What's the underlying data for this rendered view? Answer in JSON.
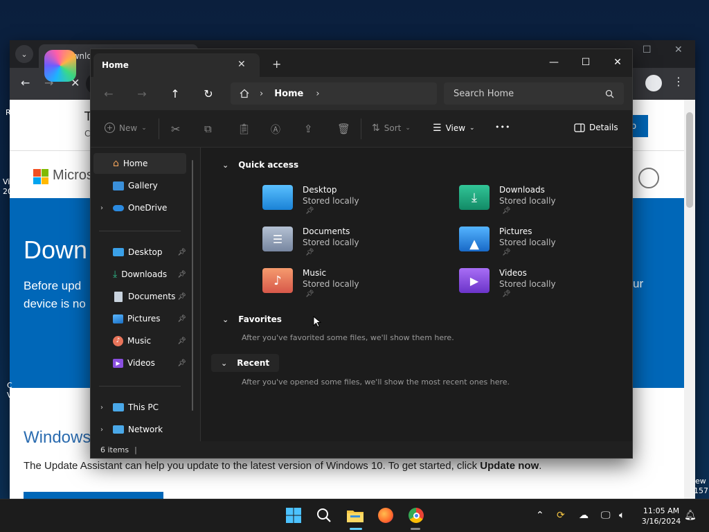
{
  "browser": {
    "tab_title": "Downlo",
    "copilot_fragment_title": "T",
    "copilot_fragment_sub": "C",
    "copilot_button_fragment": "p",
    "ms_word": "Micros",
    "hero_title": "Down",
    "hero_sub_line1": "Before upd",
    "hero_sub_line2": "device is no",
    "hero_right_fragment": "ur",
    "windows_heading": "Windows",
    "update_text_prefix": "The Update Assistant can help you update to the latest version of Windows 10. To get started, click ",
    "update_text_bold": "Update now",
    "update_text_suffix": ".",
    "left_frag_1": "R",
    "left_frag_2": "Vi",
    "left_frag_3": "20",
    "left_frag_4": "C",
    "left_frag_5": "V",
    "right_frag_1": "ew",
    "right_frag_2": "157"
  },
  "explorer": {
    "tab_title": "Home",
    "tab_close": "✕",
    "tab_new": "+",
    "window": {
      "minimize": "—",
      "maximize": "☐",
      "close": "✕"
    },
    "address": {
      "home_label": "Home"
    },
    "search_placeholder": "Search Home",
    "commands": {
      "new": "New",
      "sort": "Sort",
      "view": "View",
      "more": "•••",
      "details": "Details"
    },
    "nav": {
      "home": "Home",
      "gallery": "Gallery",
      "onedrive": "OneDrive",
      "desktop": "Desktop",
      "downloads": "Downloads",
      "documents": "Documents",
      "pictures": "Pictures",
      "music": "Music",
      "videos": "Videos",
      "thispc": "This PC",
      "network": "Network"
    },
    "sections": {
      "quick_access": "Quick access",
      "favorites": "Favorites",
      "favorites_msg": "After you've favorited some files, we'll show them here.",
      "recent": "Recent",
      "recent_msg": "After you've opened some files, we'll show the most recent ones here."
    },
    "quick_access_items": [
      {
        "name": "Desktop",
        "sub": "Stored locally",
        "color": "#3aa0e8"
      },
      {
        "name": "Downloads",
        "sub": "Stored locally",
        "color": "#1fa67a"
      },
      {
        "name": "Documents",
        "sub": "Stored locally",
        "color": "#8a9bb3"
      },
      {
        "name": "Pictures",
        "sub": "Stored locally",
        "color": "#2f8fe0"
      },
      {
        "name": "Music",
        "sub": "Stored locally",
        "color": "#e8745a"
      },
      {
        "name": "Videos",
        "sub": "Stored locally",
        "color": "#8a4fe0"
      }
    ],
    "status": "6 items"
  },
  "taskbar": {
    "time": "11:05 AM",
    "date": "3/16/2024"
  }
}
